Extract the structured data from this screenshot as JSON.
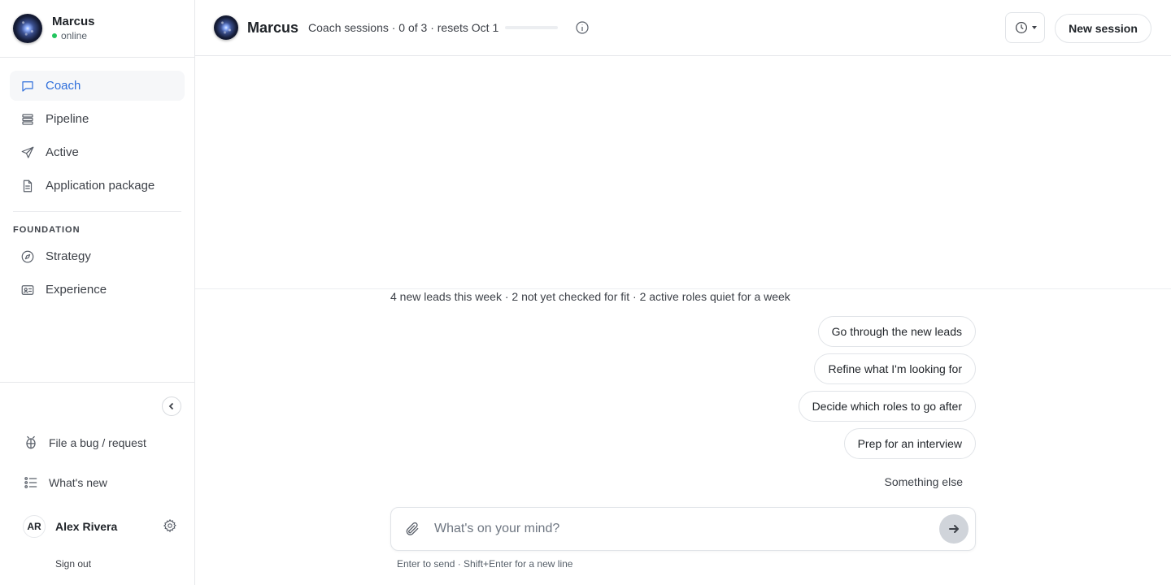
{
  "sidebar": {
    "agent_name": "Marcus",
    "agent_status": "online",
    "nav": [
      {
        "label": "Coach",
        "icon": "chat-bubble-icon",
        "active": true
      },
      {
        "label": "Pipeline",
        "icon": "stack-icon",
        "active": false
      },
      {
        "label": "Active",
        "icon": "paper-plane-icon",
        "active": false
      },
      {
        "label": "Application package",
        "icon": "document-icon",
        "active": false
      }
    ],
    "section_label": "FOUNDATION",
    "foundation": [
      {
        "label": "Strategy",
        "icon": "compass-icon"
      },
      {
        "label": "Experience",
        "icon": "id-card-icon"
      }
    ],
    "bottom": {
      "bug_label": "File a bug / request",
      "whats_new_label": "What's new",
      "user_initials": "AR",
      "user_name": "Alex Rivera",
      "sign_out": "Sign out"
    }
  },
  "header": {
    "name": "Marcus",
    "subtitle": "Coach sessions · 0 of 3 · resets Oct 1",
    "sessions_used_fraction": 0,
    "new_session_label": "New session"
  },
  "chat": {
    "summary": "4 new leads this week · 2 not yet checked for fit · 2 active roles quiet for a week",
    "suggestions": [
      "Go through the new leads",
      "Refine what I'm looking for",
      "Decide which roles to go after",
      "Prep for an interview",
      "Something else"
    ],
    "composer_placeholder": "What's on your mind?",
    "composer_hint": "Enter to send · Shift+Enter for a new line"
  },
  "colors": {
    "accent": "#2f6fdb",
    "online": "#22c55e"
  }
}
